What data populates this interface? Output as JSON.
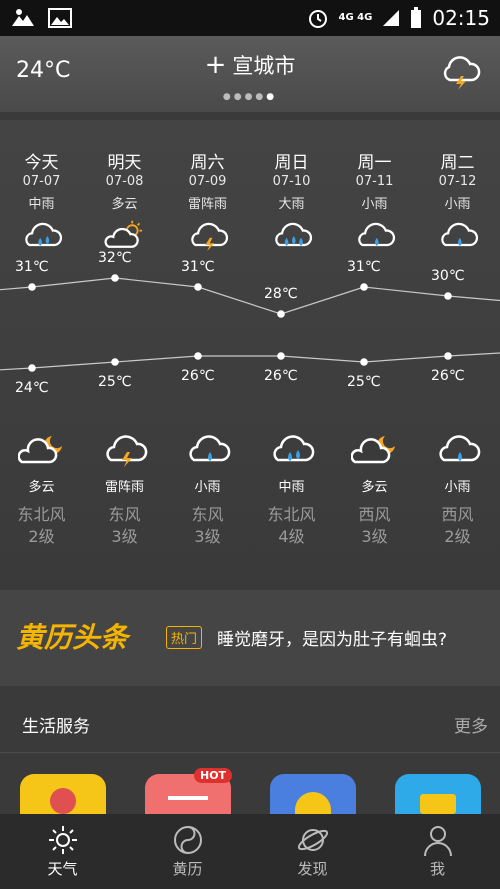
{
  "status": {
    "network": "4G 4G",
    "time": "02:15"
  },
  "header": {
    "temp": "24°C",
    "city": "宣城市",
    "plus": "+"
  },
  "days": [
    {
      "day": "今天",
      "date": "07-07",
      "cond_day": "中雨",
      "high": "31℃",
      "low": "24℃",
      "cond_night": "多云",
      "wind": "东北风",
      "level": "2级",
      "icon_day": "rain-cloud-icon",
      "icon_night": "cloud-moon-icon"
    },
    {
      "day": "明天",
      "date": "07-08",
      "cond_day": "多云",
      "high": "32℃",
      "low": "25℃",
      "cond_night": "雷阵雨",
      "wind": "东风",
      "level": "3级",
      "icon_day": "cloud-sun-icon",
      "icon_night": "thunder-cloud-icon"
    },
    {
      "day": "周六",
      "date": "07-09",
      "cond_day": "雷阵雨",
      "high": "31℃",
      "low": "26℃",
      "cond_night": "小雨",
      "wind": "东风",
      "level": "3级",
      "icon_day": "thunder-cloud-icon",
      "icon_night": "light-rain-icon"
    },
    {
      "day": "周日",
      "date": "07-10",
      "cond_day": "大雨",
      "high": "28℃",
      "low": "26℃",
      "cond_night": "中雨",
      "wind": "东北风",
      "level": "4级",
      "icon_day": "heavy-rain-icon",
      "icon_night": "rain-cloud-icon"
    },
    {
      "day": "周一",
      "date": "07-11",
      "cond_day": "小雨",
      "high": "31℃",
      "low": "25℃",
      "cond_night": "多云",
      "wind": "西风",
      "level": "3级",
      "icon_day": "light-rain-icon",
      "icon_night": "cloud-moon-icon"
    },
    {
      "day": "周二",
      "date": "07-12",
      "cond_day": "小雨",
      "high": "30℃",
      "low": "26℃",
      "cond_night": "小雨",
      "wind": "西风",
      "level": "2级",
      "icon_day": "light-rain-icon",
      "icon_night": "light-rain-icon"
    }
  ],
  "temps": {
    "high": [
      31,
      32,
      31,
      28,
      31,
      30
    ],
    "low": [
      24,
      25,
      26,
      26,
      25,
      26
    ]
  },
  "ad": {
    "logo": "黄历头条",
    "badge": "热门",
    "text": "睡觉磨牙，是因为肚子有蛔虫?"
  },
  "services": {
    "title": "生活服务",
    "more": "更多",
    "hot": "HOT",
    "apps": [
      {
        "color": "#f5c518"
      },
      {
        "color": "#f07070"
      },
      {
        "color": "#4a7fe0"
      },
      {
        "color": "#2eaae8"
      }
    ]
  },
  "tabs": [
    {
      "label": "天气",
      "icon": "sun-icon",
      "active": true
    },
    {
      "label": "黄历",
      "icon": "yin-yang-icon"
    },
    {
      "label": "发现",
      "icon": "planet-icon"
    },
    {
      "label": "我",
      "icon": "person-icon"
    }
  ]
}
